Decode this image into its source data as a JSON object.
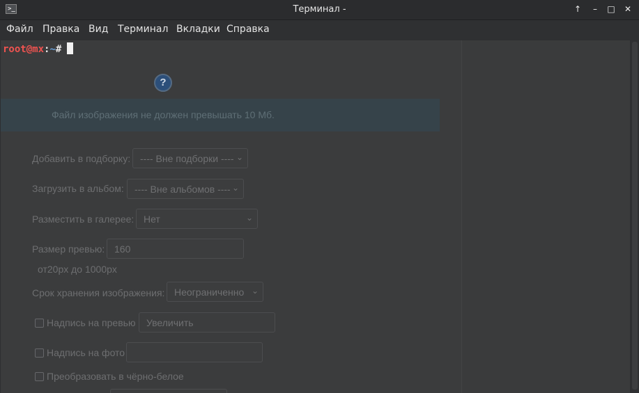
{
  "window": {
    "title": "Терминал -",
    "icon_glyph": ">_",
    "controls": {
      "keep_above": "↑",
      "minimize": "–",
      "maximize": "□",
      "close": "✕"
    }
  },
  "menu": [
    "Файл",
    "Правка",
    "Вид",
    "Терминал",
    "Вкладки",
    "Справка"
  ],
  "terminal": {
    "user_host": "root@mx",
    "separator": ":",
    "path": "~",
    "symbol": "#",
    "colors": {
      "user": "#ef5350",
      "path": "#6aa0d8",
      "background": "#3b3c3d"
    }
  },
  "background_page": {
    "help_glyph": "?",
    "notice": "Файл изображения не должен превышать 10 Мб.",
    "add_to_collection": {
      "label": "Добавить в подборку:",
      "value": "---- Вне подборки ----"
    },
    "upload_to_album": {
      "label": "Загрузить в альбом:",
      "value": "---- Вне альбомов ----"
    },
    "place_in_gallery": {
      "label": "Разместить в галерее:",
      "value": "Нет"
    },
    "preview_size": {
      "label": "Размер превью:",
      "value": "160",
      "hint": "от20px до 1000px"
    },
    "retention": {
      "label": "Срок хранения изображения:",
      "value": "Неограниченно"
    },
    "preview_caption": {
      "label": "Надпись на превью",
      "value": "Увеличить"
    },
    "photo_caption": {
      "label": "Надпись на фото",
      "value": ""
    },
    "grayscale": {
      "label": "Преобразовать в чёрно-белое"
    }
  }
}
